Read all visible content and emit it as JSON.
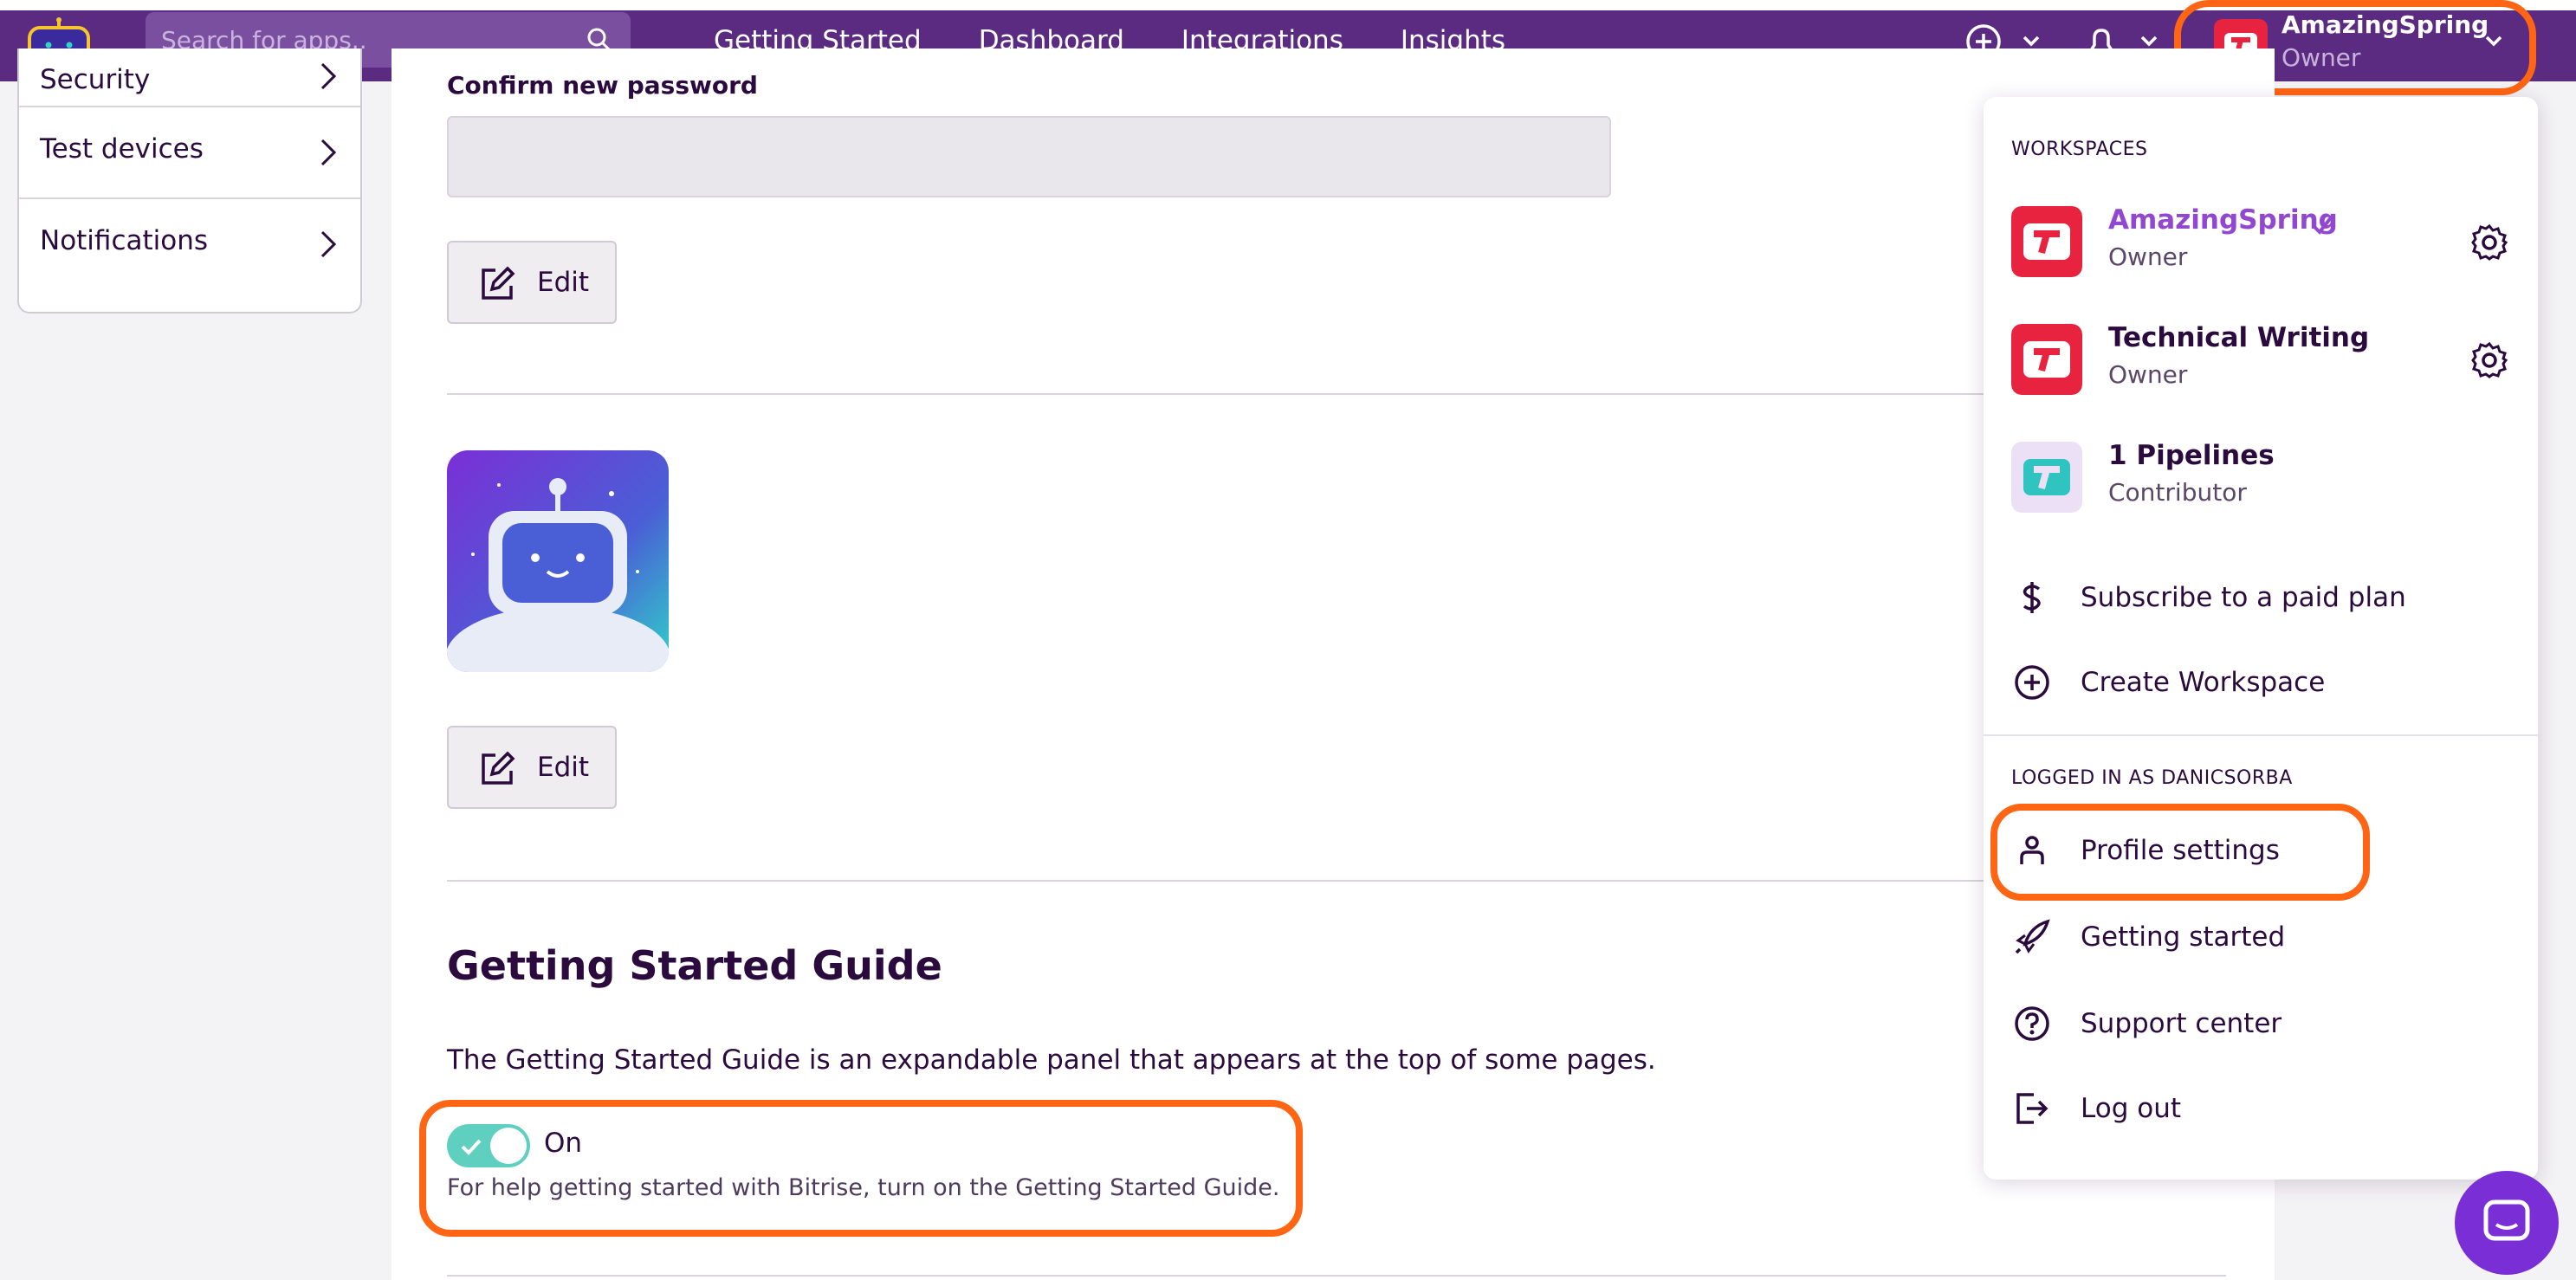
{
  "navbar": {
    "search_placeholder": "Search for apps..",
    "links": [
      "Getting Started",
      "Dashboard",
      "Integrations",
      "Insights"
    ],
    "workspace": {
      "name": "AmazingSpring",
      "role": "Owner"
    }
  },
  "sidebar": {
    "items": [
      {
        "label": "Security"
      },
      {
        "label": "Test devices"
      },
      {
        "label": "Notifications"
      }
    ]
  },
  "main": {
    "confirm_password_label": "Confirm new password",
    "edit_label": "Edit",
    "guide_title": "Getting Started Guide",
    "guide_description": "The Getting Started Guide is an expandable panel that appears at the top of some pages.",
    "toggle_state": "On",
    "toggle_help": "For help getting started with Bitrise, turn on the Getting Started Guide."
  },
  "dropdown": {
    "workspaces_heading": "WORKSPACES",
    "workspaces": [
      {
        "name": "AmazingSpring",
        "role": "Owner",
        "selected": true,
        "color": "#e8233f"
      },
      {
        "name": "Technical Writing",
        "role": "Owner",
        "selected": false,
        "color": "#e8233f"
      },
      {
        "name": "1 Pipelines",
        "role": "Contributor",
        "selected": false,
        "color": "#2fc4c0"
      }
    ],
    "actions": [
      {
        "label": "Subscribe to a paid plan",
        "icon": "dollar-icon"
      },
      {
        "label": "Create Workspace",
        "icon": "plus-circle-icon"
      }
    ],
    "logged_in_heading": "LOGGED IN AS DANICSORBA",
    "account_items": [
      {
        "label": "Profile settings",
        "icon": "person-icon"
      },
      {
        "label": "Getting started",
        "icon": "rocket-icon"
      },
      {
        "label": "Support center",
        "icon": "question-icon"
      },
      {
        "label": "Log out",
        "icon": "logout-icon"
      }
    ]
  },
  "colors": {
    "navbar": "#5b2b82",
    "highlight": "#ff6512",
    "selected_workspace": "#9247d1",
    "toggle_on": "#5fd0c0"
  }
}
